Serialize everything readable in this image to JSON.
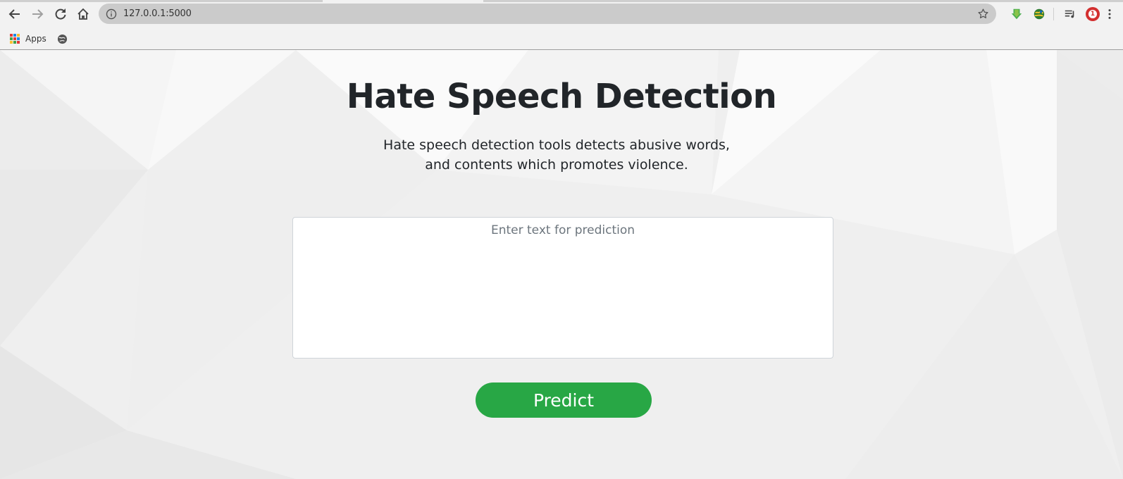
{
  "browser": {
    "url": "127.0.0.1:5000",
    "nav_icons": [
      "back-icon",
      "forward-icon",
      "reload-icon",
      "home-icon"
    ],
    "extension_icons": [
      "idm-download-icon",
      "globe-extension-icon",
      "media-playlist-icon",
      "red-circle-extension-icon",
      "kebab-menu-icon"
    ],
    "red_badge": "1",
    "bookmarks": {
      "apps_label": "Apps"
    }
  },
  "page": {
    "title": "Hate Speech Detection",
    "description": "Hate speech detection tools detects abusive words, and contents which promotes violence.",
    "input": {
      "placeholder": "Enter text for prediction",
      "value": ""
    },
    "predict_button": "Predict"
  },
  "colors": {
    "accent_green": "#28a745",
    "heading": "#212529",
    "page_background": "#efefef",
    "omnibox": "#cbcbcb"
  }
}
